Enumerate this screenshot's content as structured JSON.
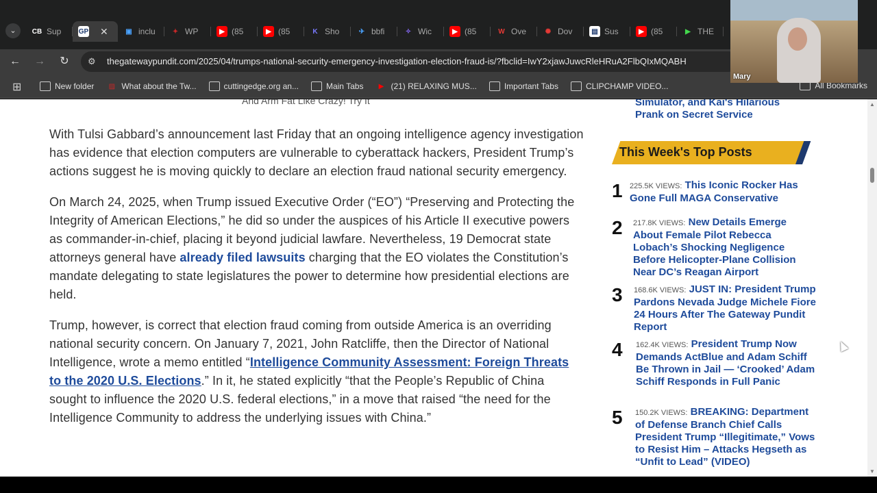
{
  "tabs": [
    {
      "label": "Sup",
      "favicon": "CB",
      "fav_bg": "#1f2020",
      "fav_fg": "#ffffff"
    },
    {
      "label": "",
      "favicon": "GP",
      "fav_bg": "#ffffff",
      "fav_fg": "#1e3a6e",
      "active": true,
      "close": "✕"
    },
    {
      "label": "inclu",
      "favicon": "▣",
      "fav_bg": "#1f2020",
      "fav_fg": "#4aa3ff"
    },
    {
      "label": "WP",
      "favicon": "✦",
      "fav_bg": "#1f2020",
      "fav_fg": "#c62828"
    },
    {
      "label": "(85",
      "favicon": "▶",
      "fav_bg": "#ff0000",
      "fav_fg": "#ffffff"
    },
    {
      "label": "(85",
      "favicon": "▶",
      "fav_bg": "#ff0000",
      "fav_fg": "#ffffff"
    },
    {
      "label": "Sho",
      "favicon": "K",
      "fav_bg": "#1f2020",
      "fav_fg": "#7a7aff"
    },
    {
      "label": "bbfi",
      "favicon": "✈",
      "fav_bg": "#1f2020",
      "fav_fg": "#4aa3ff"
    },
    {
      "label": "Wic",
      "favicon": "✧",
      "fav_bg": "#1f2020",
      "fav_fg": "#8a6cff"
    },
    {
      "label": "(85",
      "favicon": "▶",
      "fav_bg": "#ff0000",
      "fav_fg": "#ffffff"
    },
    {
      "label": "Ove",
      "favicon": "W",
      "fav_bg": "#1f2020",
      "fav_fg": "#e53935"
    },
    {
      "label": "Dov",
      "favicon": "✺",
      "fav_bg": "#1f2020",
      "fav_fg": "#e53935"
    },
    {
      "label": "Sus",
      "favicon": "▤",
      "fav_bg": "#ffffff",
      "fav_fg": "#1e3a6e"
    },
    {
      "label": "(85",
      "favicon": "▶",
      "fav_bg": "#ff0000",
      "fav_fg": "#ffffff"
    },
    {
      "label": "THE",
      "favicon": "▶",
      "fav_bg": "#1f2020",
      "fav_fg": "#43d84d"
    }
  ],
  "toolbar": {
    "back": "←",
    "forward": "→",
    "reload": "↻",
    "url": "thegatewaypundit.com/2025/04/trumps-national-security-emergency-investigation-election-fraud-is/?fbclid=IwY2xjawJuwcRleHRuA2FlbQIxMQABH"
  },
  "bookmarks": [
    {
      "label": "New folder",
      "type": "folder"
    },
    {
      "label": "What about the Tw...",
      "type": "site",
      "icon": "▨",
      "icon_color": "#c62828"
    },
    {
      "label": "cuttingedge.org an...",
      "type": "folder"
    },
    {
      "label": "Main Tabs",
      "type": "folder"
    },
    {
      "label": "(21) RELAXING MUS...",
      "type": "site",
      "icon": "▶",
      "icon_color": "#ff0000"
    },
    {
      "label": "Important Tabs",
      "type": "folder"
    },
    {
      "label": "CLIPCHAMP VIDEO...",
      "type": "folder"
    }
  ],
  "all_bookmarks": "All Bookmarks",
  "webcam": {
    "name": "Mary"
  },
  "article": {
    "ad_caption": "And Arm Fat Like Crazy! Try It",
    "p1": "With Tulsi Gabbard’s announcement last Friday that an ongoing intelligence agency investigation has evidence that election computers are vulnerable to cyberattack hackers, President Trump’s actions suggest he is moving quickly to declare an election fraud national security emergency.",
    "p2a": "On March 24, 2025, when Trump issued Executive Order (“EO”) “Preserving and Protecting the Integrity of American Elections,” he did so under the auspices of his Article II executive powers as commander-in-chief, placing it beyond judicial lawfare. Nevertheless, 19 Democrat state attorneys general have ",
    "p2link": "already filed lawsuits",
    "p2b": " charging that the EO violates the Constitution’s mandate delegating to state legislatures the power to determine how presidential elections are held.",
    "p3a": "Trump, however, is correct that election fraud coming from outside America is an overriding national security concern. On January 7, 2021, John Ratcliffe, then the Director of National Intelligence, wrote a memo entitled “",
    "p3link": "Intelligence Community Assessment: Foreign Threats to the 2020 U.S. Elections",
    "p3b": ".” In it, he stated explicitly “that the People’s Republic of China sought to influence the 2020 U.S. federal elections,” in a move that raised “the need for the Intelligence Community to address the underlying issues with China.”"
  },
  "sidebar": {
    "prev_link": "Simulator, and Kai's Hilarious Prank on Secret Service",
    "top_posts_title": "This Week's Top Posts",
    "posts": [
      {
        "num": "1",
        "views": "225.5K VIEWS:",
        "title": "This Iconic Rocker Has Gone Full MAGA Conservative"
      },
      {
        "num": "2",
        "views": "217.8K VIEWS:",
        "title": "New Details Emerge About Female Pilot Rebecca Lobach’s Shocking Negligence Before Helicopter-Plane Collision Near DC’s Reagan Airport"
      },
      {
        "num": "3",
        "views": "168.6K VIEWS:",
        "title": "JUST IN: President Trump Pardons Nevada Judge Michele Fiore 24 Hours After The Gateway Pundit Report"
      },
      {
        "num": "4",
        "views": "162.4K VIEWS:",
        "title": "President Trump Now Demands ActBlue and Adam Schiff Be Thrown in Jail — ‘Crooked’ Adam Schiff Responds in Full Panic"
      },
      {
        "num": "5",
        "views": "150.2K VIEWS:",
        "title": "BREAKING: Department of Defense Branch Chief Calls President Trump “Illegitimate,” Vows to Resist Him – Attacks Hegseth as “Unfit to Lead” (VIDEO)"
      }
    ]
  },
  "colors": {
    "link": "#1e4b9b",
    "accent": "#e9b01f",
    "accent_edge": "#1e3a6e"
  }
}
